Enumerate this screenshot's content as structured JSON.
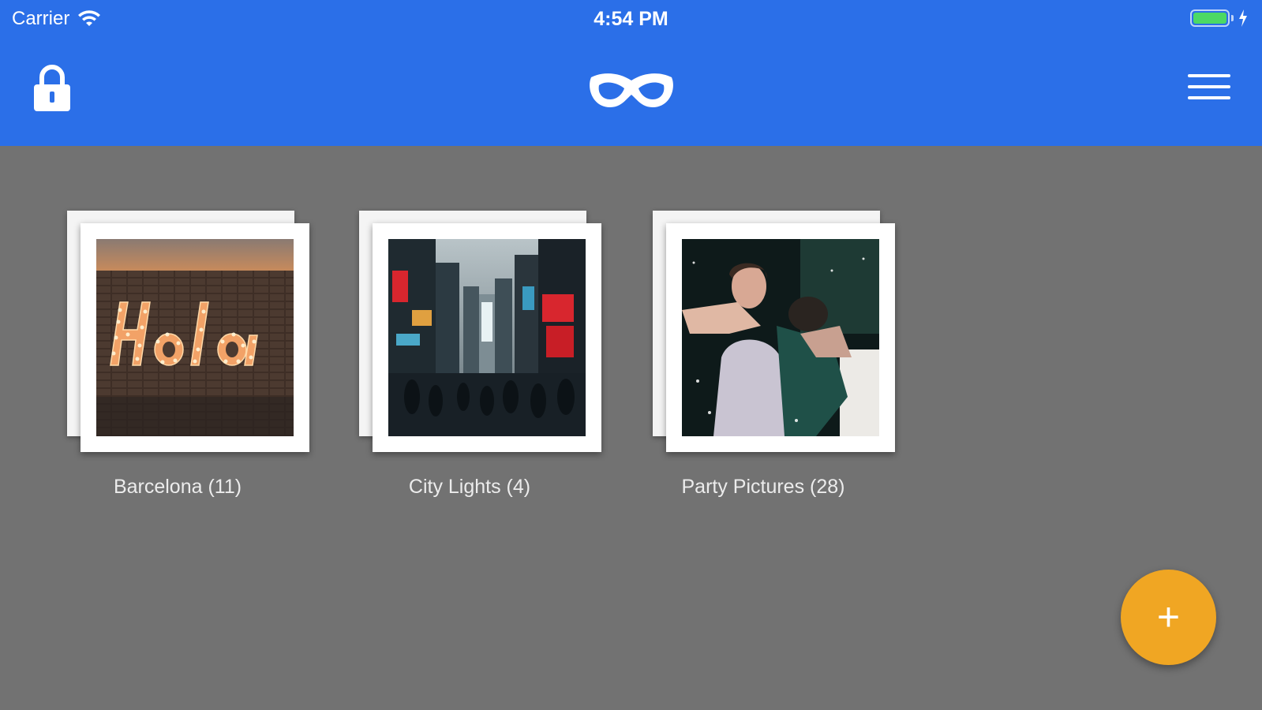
{
  "status_bar": {
    "carrier": "Carrier",
    "time": "4:54 PM",
    "wifi_icon": "wifi-icon",
    "battery_icon": "battery-icon",
    "charging_icon": "bolt-icon",
    "battery_level": 1.0
  },
  "nav_bar": {
    "background_color": "#2b6fe8",
    "left_icon": "lock-icon",
    "logo_icon": "mask-icon",
    "right_icon": "hamburger-menu-icon"
  },
  "albums": [
    {
      "label": "Barcelona (11)",
      "photo_icon": "hola-sign-photo"
    },
    {
      "label": "City Lights (4)",
      "photo_icon": "city-street-photo"
    },
    {
      "label": "Party Pictures (28)",
      "photo_icon": "party-photo"
    }
  ],
  "fab": {
    "label": "+",
    "color": "#f0a623"
  }
}
